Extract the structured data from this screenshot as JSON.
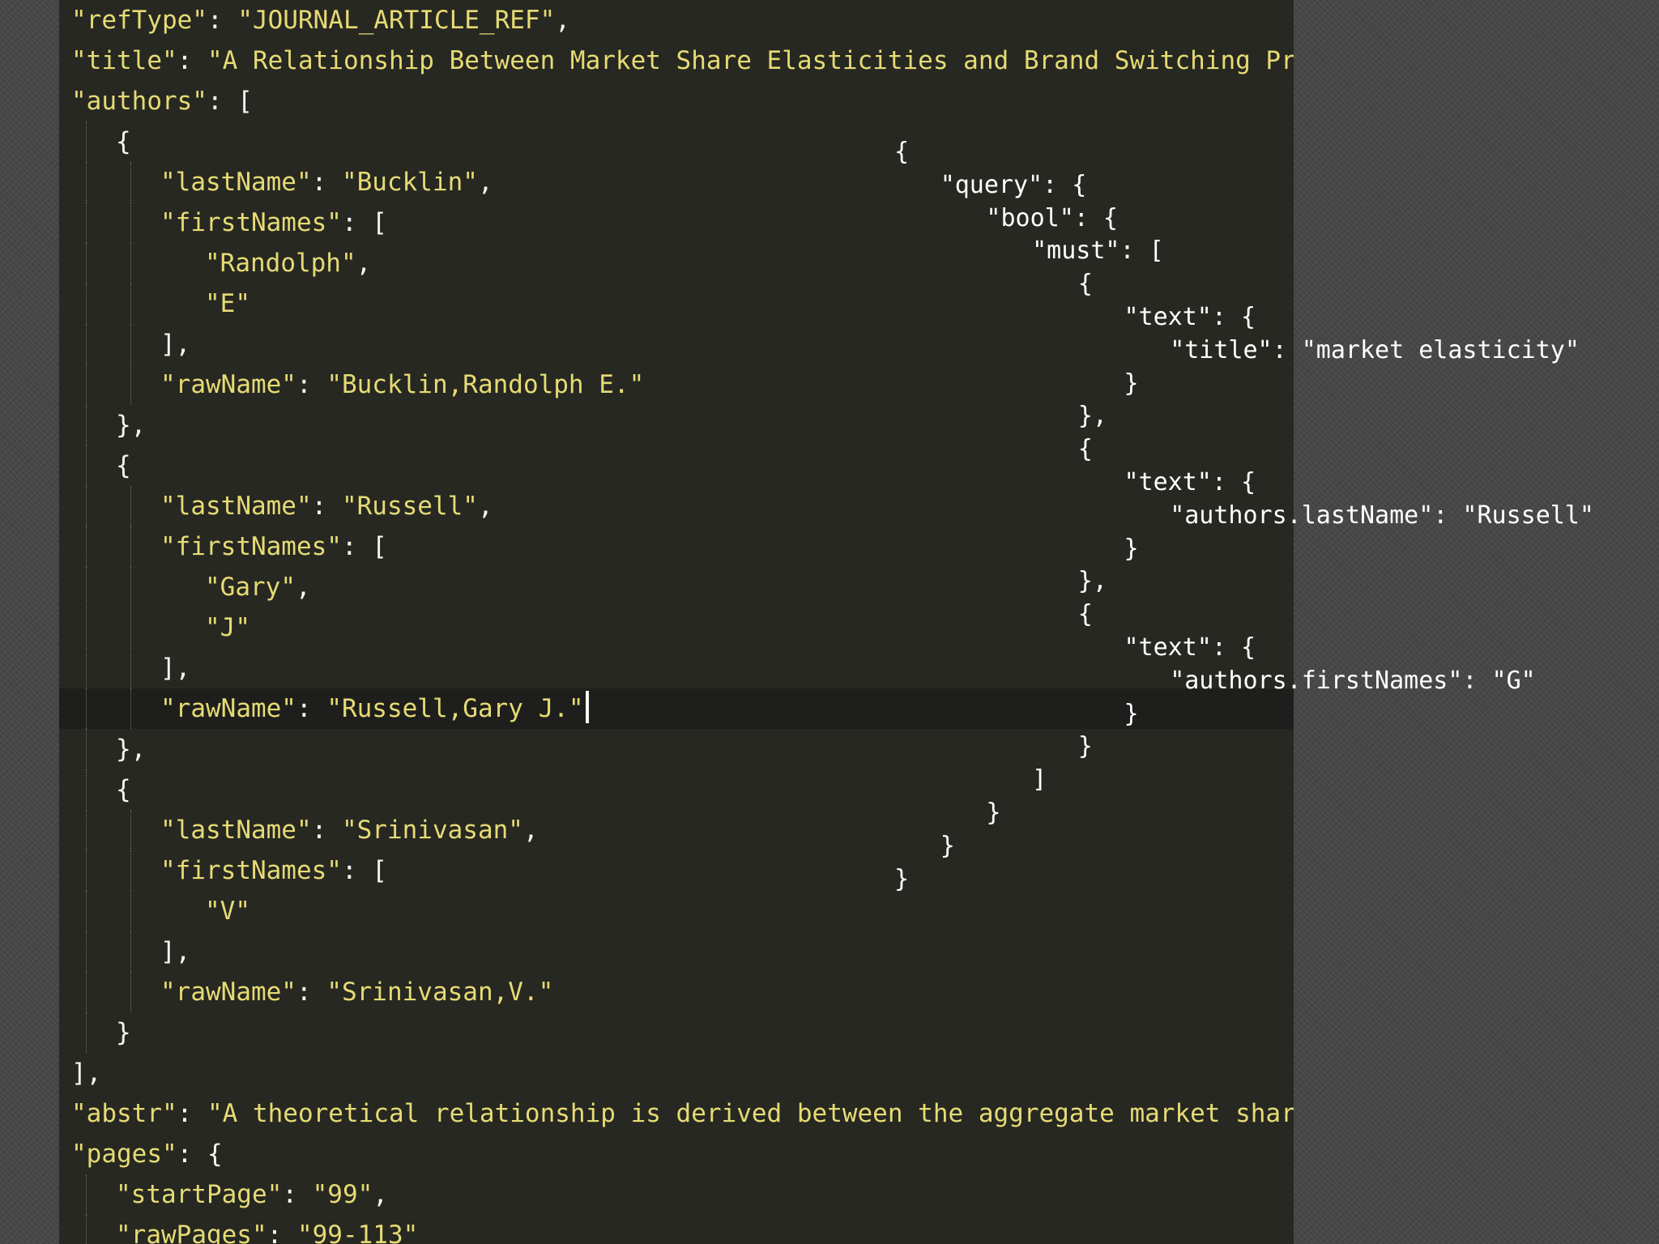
{
  "editor": {
    "lines": [
      {
        "indent": 0,
        "guides": [],
        "parts": [
          {
            "t": "\"refType\"",
            "c": "k"
          },
          {
            "t": ": "
          },
          {
            "t": "\"JOURNAL_ARTICLE_REF\"",
            "c": "k"
          },
          {
            "t": ","
          }
        ]
      },
      {
        "indent": 0,
        "guides": [],
        "parts": [
          {
            "t": "\"title\"",
            "c": "k"
          },
          {
            "t": ": "
          },
          {
            "t": "\"A Relationship Between Market Share Elasticities and Brand Switching Prob",
            "c": "k"
          }
        ]
      },
      {
        "indent": 0,
        "guides": [],
        "parts": [
          {
            "t": "\"authors\"",
            "c": "k"
          },
          {
            "t": ": ["
          }
        ]
      },
      {
        "indent": 1,
        "guides": [
          0
        ],
        "parts": [
          {
            "t": "{"
          }
        ]
      },
      {
        "indent": 2,
        "guides": [
          0,
          1
        ],
        "parts": [
          {
            "t": "\"lastName\"",
            "c": "k"
          },
          {
            "t": ": "
          },
          {
            "t": "\"Bucklin\"",
            "c": "k"
          },
          {
            "t": ","
          }
        ]
      },
      {
        "indent": 2,
        "guides": [
          0,
          1
        ],
        "parts": [
          {
            "t": "\"firstNames\"",
            "c": "k"
          },
          {
            "t": ": ["
          }
        ]
      },
      {
        "indent": 3,
        "guides": [
          0,
          1
        ],
        "parts": [
          {
            "t": "\"Randolph\"",
            "c": "k"
          },
          {
            "t": ","
          }
        ]
      },
      {
        "indent": 3,
        "guides": [
          0,
          1
        ],
        "parts": [
          {
            "t": "\"E\"",
            "c": "k"
          }
        ]
      },
      {
        "indent": 2,
        "guides": [
          0,
          1
        ],
        "parts": [
          {
            "t": "],"
          }
        ]
      },
      {
        "indent": 2,
        "guides": [
          0,
          1
        ],
        "parts": [
          {
            "t": "\"rawName\"",
            "c": "k"
          },
          {
            "t": ": "
          },
          {
            "t": "\"Bucklin,Randolph E.\"",
            "c": "k"
          }
        ]
      },
      {
        "indent": 1,
        "guides": [
          0
        ],
        "parts": [
          {
            "t": "},"
          }
        ]
      },
      {
        "indent": 1,
        "guides": [
          0
        ],
        "parts": [
          {
            "t": "{"
          }
        ]
      },
      {
        "indent": 2,
        "guides": [
          0,
          1
        ],
        "parts": [
          {
            "t": "\"lastName\"",
            "c": "k"
          },
          {
            "t": ": "
          },
          {
            "t": "\"Russell\"",
            "c": "k"
          },
          {
            "t": ","
          }
        ]
      },
      {
        "indent": 2,
        "guides": [
          0,
          1
        ],
        "parts": [
          {
            "t": "\"firstNames\"",
            "c": "k"
          },
          {
            "t": ": ["
          }
        ]
      },
      {
        "indent": 3,
        "guides": [
          0,
          1
        ],
        "parts": [
          {
            "t": "\"Gary\"",
            "c": "k"
          },
          {
            "t": ","
          }
        ]
      },
      {
        "indent": 3,
        "guides": [
          0,
          1
        ],
        "parts": [
          {
            "t": "\"J\"",
            "c": "k"
          }
        ]
      },
      {
        "indent": 2,
        "guides": [
          0,
          1
        ],
        "parts": [
          {
            "t": "],"
          }
        ]
      },
      {
        "indent": 2,
        "guides": [
          0,
          1
        ],
        "current": true,
        "cursor": true,
        "parts": [
          {
            "t": "\"rawName\"",
            "c": "k"
          },
          {
            "t": ": "
          },
          {
            "t": "\"Russell,Gary J.\"",
            "c": "k"
          }
        ]
      },
      {
        "indent": 1,
        "guides": [
          0
        ],
        "parts": [
          {
            "t": "},"
          }
        ]
      },
      {
        "indent": 1,
        "guides": [
          0
        ],
        "parts": [
          {
            "t": "{"
          }
        ]
      },
      {
        "indent": 2,
        "guides": [
          0,
          1
        ],
        "parts": [
          {
            "t": "\"lastName\"",
            "c": "k"
          },
          {
            "t": ": "
          },
          {
            "t": "\"Srinivasan\"",
            "c": "k"
          },
          {
            "t": ","
          }
        ]
      },
      {
        "indent": 2,
        "guides": [
          0,
          1
        ],
        "parts": [
          {
            "t": "\"firstNames\"",
            "c": "k"
          },
          {
            "t": ": ["
          }
        ]
      },
      {
        "indent": 3,
        "guides": [
          0,
          1
        ],
        "parts": [
          {
            "t": "\"V\"",
            "c": "k"
          }
        ]
      },
      {
        "indent": 2,
        "guides": [
          0,
          1
        ],
        "parts": [
          {
            "t": "],"
          }
        ]
      },
      {
        "indent": 2,
        "guides": [
          0,
          1
        ],
        "parts": [
          {
            "t": "\"rawName\"",
            "c": "k"
          },
          {
            "t": ": "
          },
          {
            "t": "\"Srinivasan,V.\"",
            "c": "k"
          }
        ]
      },
      {
        "indent": 1,
        "guides": [
          0
        ],
        "parts": [
          {
            "t": "}"
          }
        ]
      },
      {
        "indent": 0,
        "guides": [],
        "parts": [
          {
            "t": "],"
          }
        ]
      },
      {
        "indent": 0,
        "guides": [],
        "parts": [
          {
            "t": "\"abstr\"",
            "c": "k"
          },
          {
            "t": ": "
          },
          {
            "t": "\"A theoretical relationship is derived between the aggregate market share",
            "c": "k"
          }
        ]
      },
      {
        "indent": 0,
        "guides": [],
        "parts": [
          {
            "t": "\"pages\"",
            "c": "k"
          },
          {
            "t": ": {"
          }
        ]
      },
      {
        "indent": 1,
        "guides": [
          0
        ],
        "parts": [
          {
            "t": "\"startPage\"",
            "c": "k"
          },
          {
            "t": ": "
          },
          {
            "t": "\"99\"",
            "c": "k"
          },
          {
            "t": ","
          }
        ]
      },
      {
        "indent": 1,
        "guides": [
          0
        ],
        "parts": [
          {
            "t": "\"rawPages\"",
            "c": "k"
          },
          {
            "t": ": "
          },
          {
            "t": "\"99-113\"",
            "c": "k"
          }
        ]
      }
    ]
  },
  "query_overlay": {
    "lines": [
      {
        "indent": 0,
        "text": "{"
      },
      {
        "indent": 1,
        "text": "\"query\": {"
      },
      {
        "indent": 2,
        "text": "\"bool\": {"
      },
      {
        "indent": 3,
        "text": "\"must\": ["
      },
      {
        "indent": 4,
        "text": "{"
      },
      {
        "indent": 5,
        "text": "\"text\": {"
      },
      {
        "indent": 6,
        "text": "\"title\": \"market elasticity\""
      },
      {
        "indent": 5,
        "text": "}"
      },
      {
        "indent": 4,
        "text": "},"
      },
      {
        "indent": 4,
        "text": "{"
      },
      {
        "indent": 5,
        "text": "\"text\": {"
      },
      {
        "indent": 6,
        "text": "\"authors.lastName\": \"Russell\""
      },
      {
        "indent": 5,
        "text": "}"
      },
      {
        "indent": 4,
        "text": "},"
      },
      {
        "indent": 4,
        "text": "{"
      },
      {
        "indent": 5,
        "text": "\"text\": {"
      },
      {
        "indent": 6,
        "text": "\"authors.firstNames\": \"G\""
      },
      {
        "indent": 5,
        "text": "}"
      },
      {
        "indent": 4,
        "text": "}"
      },
      {
        "indent": 3,
        "text": "]"
      },
      {
        "indent": 2,
        "text": "}"
      },
      {
        "indent": 1,
        "text": "}"
      },
      {
        "indent": 0,
        "text": "}"
      }
    ]
  },
  "colors": {
    "editor_bg": "#272822",
    "key_string": "#e6db74",
    "punctuation": "#f8f8f2",
    "overlay_text": "#ffffff",
    "desktop_bg": "#474747"
  }
}
